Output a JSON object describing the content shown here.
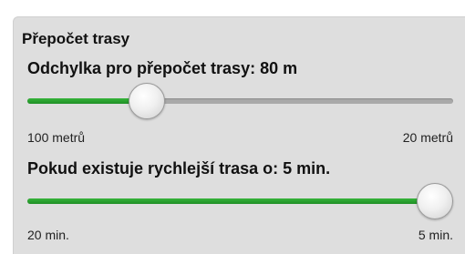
{
  "section_title": "Přepočet trasy",
  "deviation": {
    "label": "Odchylka pro přepočet trasy: 80 m",
    "value_fraction": 0.26,
    "min_label": "100 metrů",
    "max_label": "20 metrů"
  },
  "faster_route": {
    "label": "Pokud existuje rychlejší trasa o: 5 min.",
    "value_fraction": 1.0,
    "min_label": "20 min.",
    "max_label": "5 min."
  },
  "colors": {
    "accent": "#2aa52f",
    "panel": "#dedede",
    "track": "#a9a9a9"
  }
}
